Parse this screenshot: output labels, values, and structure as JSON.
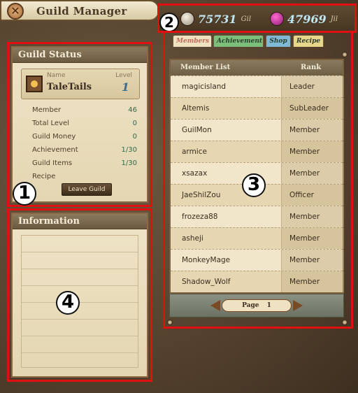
{
  "window": {
    "title": "Guild Manager"
  },
  "currency": {
    "gil": {
      "value": "75731",
      "unit": "Gil"
    },
    "jil": {
      "value": "47969",
      "unit": "Jil"
    }
  },
  "markers": [
    "1",
    "2",
    "3",
    "4"
  ],
  "guild_status": {
    "header": "Guild Status",
    "name_label": "Name",
    "level_label": "Level",
    "name": "TaleTails",
    "level": "1",
    "stats": [
      {
        "label": "Member",
        "value": "46"
      },
      {
        "label": "Total Level",
        "value": "0"
      },
      {
        "label": "Guild Money",
        "value": "0"
      },
      {
        "label": "Achievement",
        "value": "1/30"
      },
      {
        "label": "Guild Items",
        "value": "1/30"
      },
      {
        "label": "Recipe",
        "value": ""
      }
    ],
    "leave_button": "Leave Guild"
  },
  "information": {
    "header": "Information"
  },
  "tabs": [
    "Members",
    "Achievement",
    "Shop",
    "Recipe"
  ],
  "members": {
    "columns": [
      "Member List",
      "Rank"
    ],
    "rows": [
      {
        "name": "magicisland",
        "rank": "Leader"
      },
      {
        "name": "Altemis",
        "rank": "SubLeader"
      },
      {
        "name": "GuilMon",
        "rank": "Member"
      },
      {
        "name": "armice",
        "rank": "Member"
      },
      {
        "name": "xsazax",
        "rank": "Member"
      },
      {
        "name": "JaeShilZou",
        "rank": "Officer"
      },
      {
        "name": "frozeza88",
        "rank": "Member"
      },
      {
        "name": "asheji",
        "rank": "Member"
      },
      {
        "name": "MonkeyMage",
        "rank": "Member"
      },
      {
        "name": "Shadow_Wolf",
        "rank": "Member"
      }
    ],
    "page_label": "Page",
    "page": "1"
  }
}
